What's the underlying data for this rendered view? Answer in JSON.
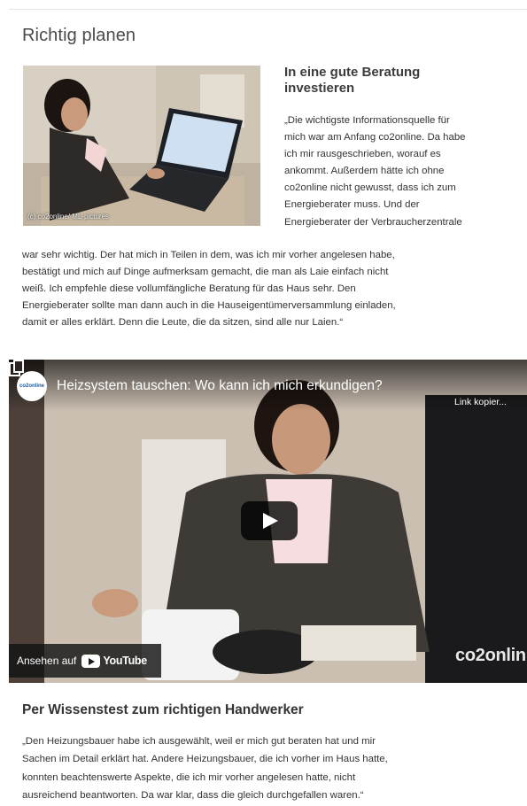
{
  "section": {
    "title": "Richtig planen"
  },
  "photo": {
    "credit": "(c) co2online/ ML-pictures"
  },
  "article": {
    "heading_line1": "In eine gute Beratung",
    "heading_line2": "investieren",
    "quote_right_lines": [
      "„Die wichtigste Informationsquelle für",
      "mich war am Anfang co2online. Da habe",
      "ich mir rausgeschrieben, worauf es",
      "ankommt. Außerdem hätte ich ohne",
      "co2online nicht gewusst, dass ich zum",
      "Energieberater muss. Und der",
      "Energieberater der Verbraucherzentrale"
    ],
    "quote_full_lines": [
      "war sehr wichtig. Der hat mich in Teilen in dem, was ich mir vorher angelesen habe,",
      "bestätigt und mich auf Dinge aufmerksam gemacht, die man als Laie einfach nicht",
      "weiß. Ich empfehle diese vollumfängliche Beratung für das Haus sehr. Den",
      "Energieberater sollte man dann auch in die Hauseigentümerversammlung einladen,",
      "damit er alles erklärt. Denn die Leute, die da sitzen, sind alle nur Laien.“"
    ]
  },
  "video": {
    "channel": "co2online",
    "title": "Heizsystem tauschen: Wo kann ich mich erkundigen?",
    "copy_link_label": "Link kopier...",
    "watch_on_label": "Ansehen auf",
    "youtube_label": "YouTube",
    "watermark": "co2onlin",
    "icons": [
      "copy-icon",
      "play-icon",
      "youtube-logo-icon"
    ]
  },
  "section2": {
    "heading": "Per Wissenstest zum richtigen Handwerker",
    "quote_lines": [
      "„Den Heizungsbauer habe ich ausgewählt, weil er mich gut beraten hat und mir",
      "Sachen im Detail erklärt hat. Andere Heizungsbauer, die ich vorher im Haus hatte,",
      "konnten beachtenswerte Aspekte, die ich mir vorher angelesen hatte, nicht",
      "ausreichend beantworten. Da war klar, dass die gleich durchgefallen waren.“"
    ]
  }
}
